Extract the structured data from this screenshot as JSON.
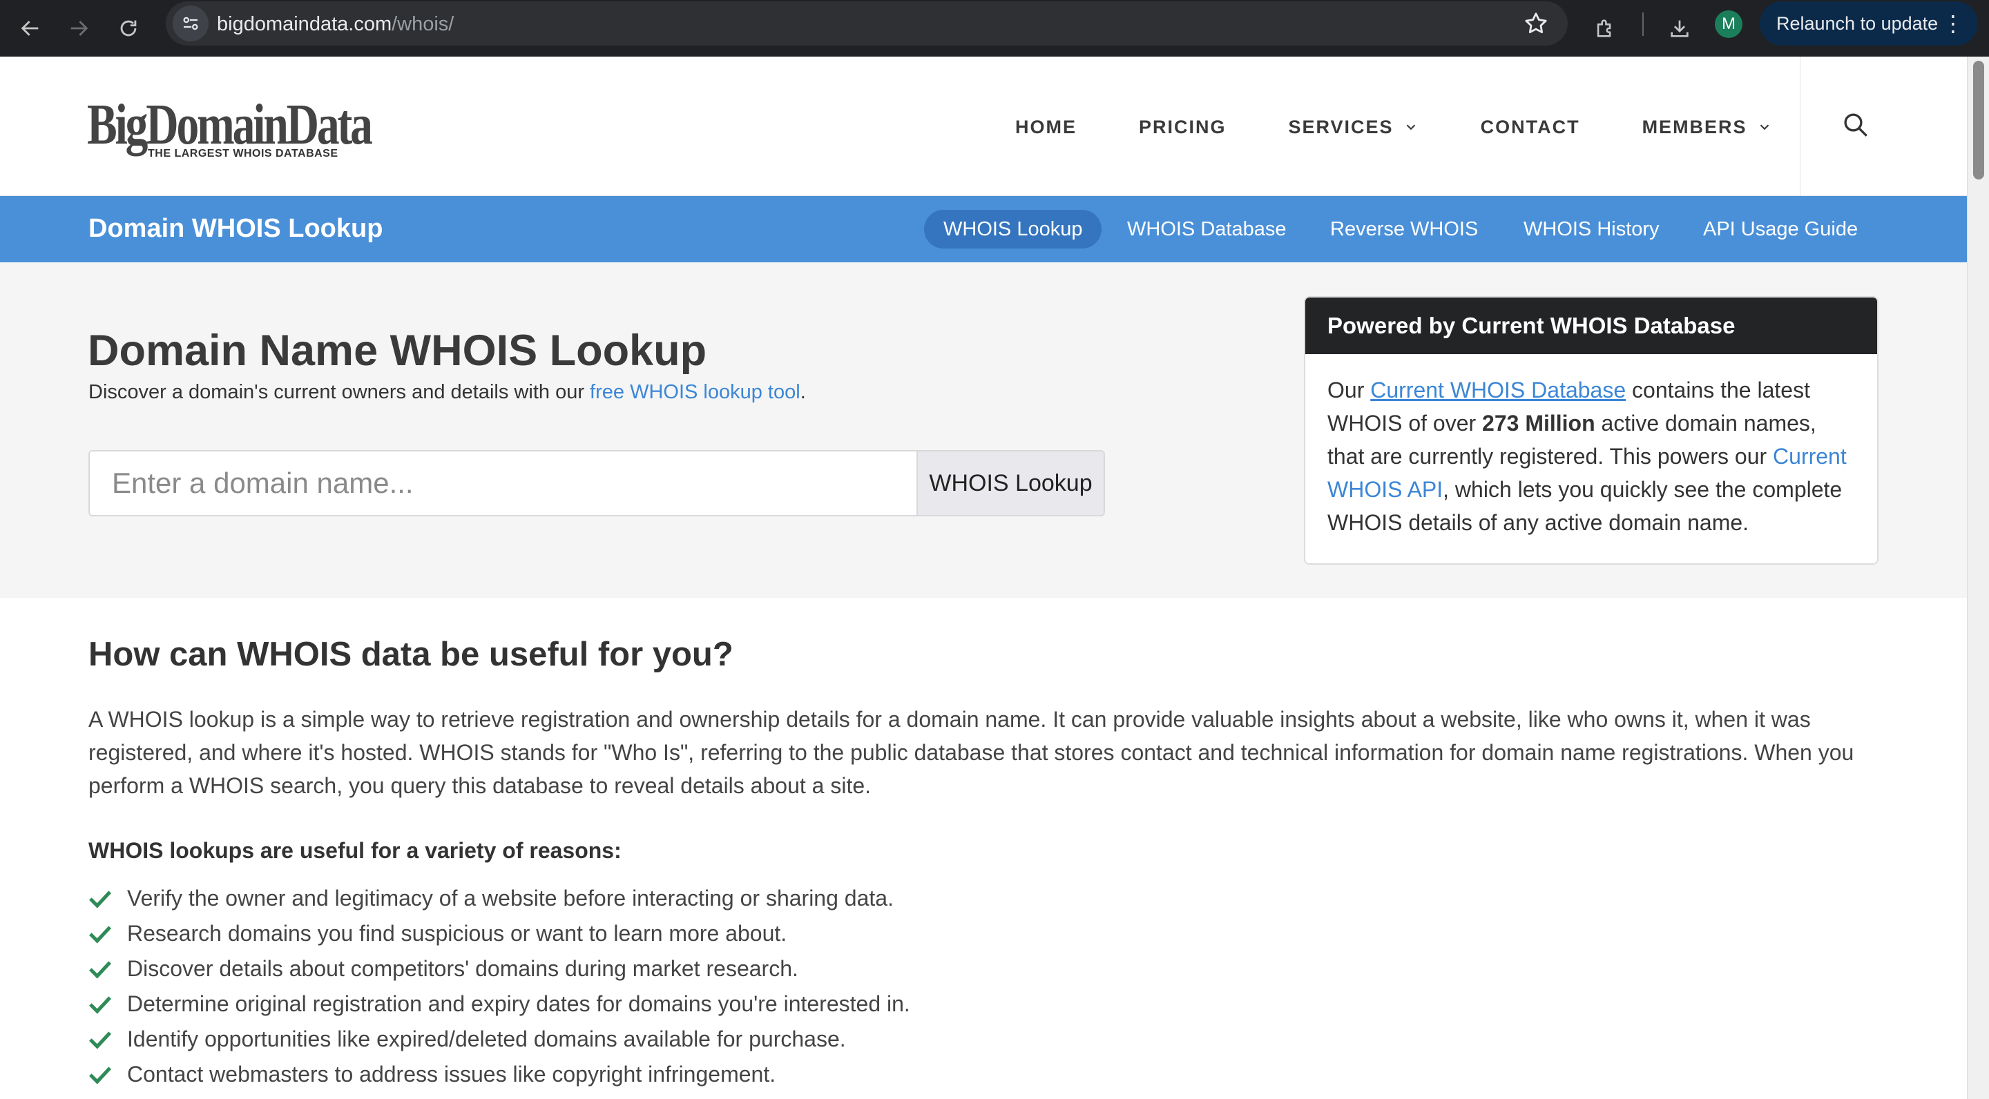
{
  "browser": {
    "url_host": "bigdomaindata.com",
    "url_path": "/whois/",
    "profile_initial": "M",
    "relaunch_label": "Relaunch to update",
    "icons": [
      "back-arrow-icon",
      "forward-arrow-icon",
      "reload-icon",
      "site-info-icon",
      "bookmark-star-icon",
      "extensions-icon",
      "download-icon",
      "kebab-menu-icon"
    ]
  },
  "header": {
    "logo_text": "BigDomainData",
    "logo_tagline": "THE LARGEST WHOIS DATABASE",
    "nav": [
      {
        "label": "HOME",
        "dropdown": false
      },
      {
        "label": "PRICING",
        "dropdown": false
      },
      {
        "label": "SERVICES",
        "dropdown": true
      },
      {
        "label": "CONTACT",
        "dropdown": false
      },
      {
        "label": "MEMBERS",
        "dropdown": true
      }
    ]
  },
  "subbar": {
    "title": "Domain WHOIS Lookup",
    "links": [
      "WHOIS Lookup",
      "WHOIS Database",
      "Reverse WHOIS",
      "WHOIS History",
      "API Usage Guide"
    ],
    "active_index": 0
  },
  "hero": {
    "title": "Domain Name WHOIS Lookup",
    "subtitle_prefix": "Discover a domain's current owners and details with our ",
    "subtitle_link": "free WHOIS lookup tool",
    "subtitle_suffix": ".",
    "input_placeholder": "Enter a domain name...",
    "input_value": "",
    "button_label": "WHOIS Lookup"
  },
  "card": {
    "title": "Powered by Current WHOIS Database",
    "text_1": "Our ",
    "link_1": "Current WHOIS Database",
    "text_2": " contains the latest WHOIS of over ",
    "bold": "273 Million",
    "text_3": " active domain names, that are currently registered. This powers our ",
    "link_2": "Current WHOIS API",
    "text_4": ", which lets you quickly see the complete WHOIS details of any active domain name."
  },
  "content": {
    "heading": "How can WHOIS data be useful for you?",
    "paragraph": "A WHOIS lookup is a simple way to retrieve registration and ownership details for a domain name. It can provide valuable insights about a website, like who owns it, when it was registered, and where it's hosted. WHOIS stands for \"Who Is\", referring to the public database that stores contact and technical information for domain name registrations. When you perform a WHOIS search, you query this database to reveal details about a site.",
    "reasons_title": "WHOIS lookups are useful for a variety of reasons:",
    "reasons": [
      "Verify the owner and legitimacy of a website before interacting or sharing data.",
      "Research domains you find suspicious or want to learn more about.",
      "Discover details about competitors' domains during market research.",
      "Determine original registration and expiry dates for domains you're interested in.",
      "Identify opportunities like expired/deleted domains available for purchase.",
      "Contact webmasters to address issues like copyright infringement."
    ]
  },
  "colors": {
    "brand_blue": "#4a90d9",
    "active_pill": "#3575bf",
    "link": "#3b86d6",
    "check_green": "#2e8b57",
    "card_header": "#222426"
  }
}
